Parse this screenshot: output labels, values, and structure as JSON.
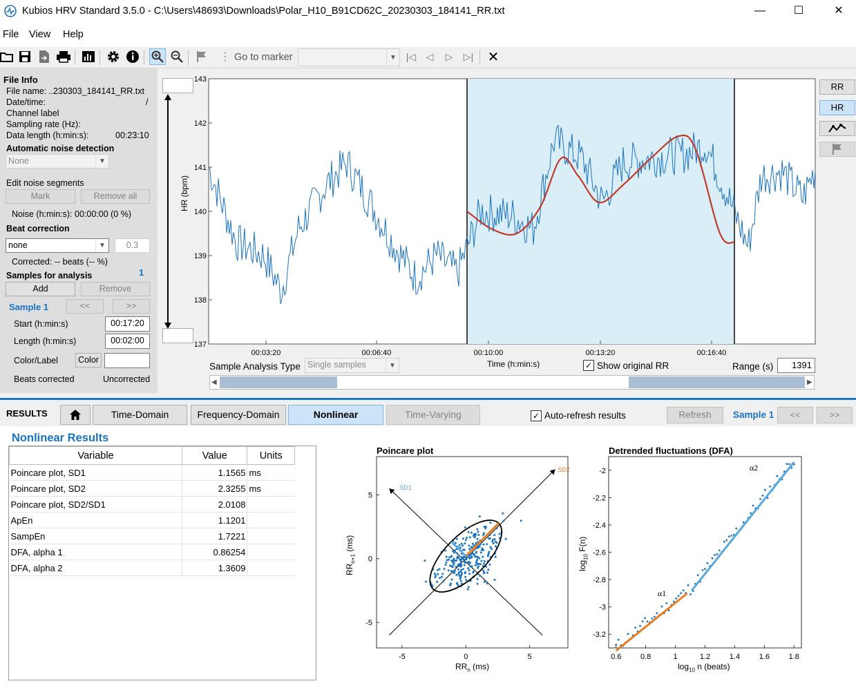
{
  "window": {
    "title": "Kubios HRV Standard 3.5.0 - C:\\Users\\48693\\Downloads\\Polar_H10_B91CD62C_20230303_184141_RR.txt",
    "controls": [
      "—",
      "☐",
      "✕"
    ]
  },
  "menu": [
    "File",
    "View",
    "Help"
  ],
  "toolbar": {
    "go_to_marker_label": "Go to marker",
    "icons": [
      "open-icon",
      "save-icon",
      "export-icon",
      "print-icon",
      "report-icon",
      "settings-icon",
      "info-icon",
      "zoom-in-icon",
      "zoom-out-icon",
      "flag-icon",
      "first-icon",
      "prev-icon",
      "next-icon",
      "last-icon",
      "close-icon"
    ]
  },
  "left_panel": {
    "file_info_title": "File Info",
    "file_name_label": "File name:",
    "file_name_value": "..230303_184141_RR.txt",
    "datetime_label": "Date/time:",
    "datetime_value": "/",
    "channel_label": "Channel label",
    "sampling_label": "Sampling rate (Hz):",
    "length_label": "Data length (h:min:s):",
    "length_value": "00:23:10",
    "auto_noise_title": "Automatic noise detection",
    "auto_noise_value": "None",
    "edit_noise_title": "Edit noise segments",
    "mark_label": "Mark",
    "remove_all_label": "Remove all",
    "noise_text": "Noise (h:min:s): 00:00:00 (0 %)",
    "beat_correction_title": "Beat correction",
    "beat_correction_value": "none",
    "beat_threshold": "0.3",
    "corrected_text": "Corrected: -- beats (-- %)",
    "samples_title": "Samples for analysis",
    "samples_count": "1",
    "add_label": "Add",
    "remove_label": "Remove",
    "sample_label": "Sample 1",
    "prev_label": "<<",
    "next_label": ">>",
    "start_label": "Start (h:min:s)",
    "start_value": "00:17:20",
    "length2_label": "Length (h:min:s)",
    "length2_value": "00:02:00",
    "color_label_label": "Color/Label",
    "color_btn": "Color",
    "beats_corrected_label": "Beats corrected",
    "beats_corrected_value": "Uncorrected"
  },
  "right_buttons": {
    "rr": "RR",
    "hr": "HR"
  },
  "hr_chart": {
    "ylabel": "HR (bpm)",
    "xlabel": "Time (h:min:s)",
    "yticks": [
      "143",
      "142",
      "141",
      "140",
      "139",
      "138",
      "137"
    ],
    "xticks": [
      "00:03:20",
      "00:06:40",
      "00:10:00",
      "00:13:20",
      "00:16:40"
    ],
    "sample_type_label": "Sample Analysis Type",
    "sample_type_value": "Single samples",
    "show_original_label": "Show original RR",
    "range_label": "Range (s)",
    "range_value": "1391",
    "line_color": "#1a73c2",
    "trend_color": "#c0392b",
    "highlight_color": "#d9eef7"
  },
  "results": {
    "label": "RESULTS",
    "tabs": [
      "Time-Domain",
      "Frequency-Domain",
      "Nonlinear",
      "Time-Varying"
    ],
    "active_tab": "Nonlinear",
    "auto_refresh_label": "Auto-refresh results",
    "refresh_label": "Refresh",
    "sample_label": "Sample 1",
    "prev_label": "<<",
    "next_label": ">>",
    "title": "Nonlinear Results",
    "columns": [
      "Variable",
      "Value",
      "Units"
    ],
    "rows": [
      [
        "Poincare plot, SD1",
        "1.1565",
        "ms"
      ],
      [
        "Poincare plot, SD2",
        "2.3255",
        "ms"
      ],
      [
        "Poincare plot, SD2/SD1",
        "2.0108",
        ""
      ],
      [
        "ApEn",
        "1.1201",
        ""
      ],
      [
        "SampEn",
        "1.7221",
        ""
      ],
      [
        "DFA, alpha 1",
        "0.86254",
        ""
      ],
      [
        "DFA, alpha 2",
        "1.3609",
        ""
      ]
    ]
  },
  "poincare": {
    "title": "Poincare plot",
    "xlabel": "RRn (ms)",
    "ylabel": "RRn+1 (ms)",
    "ticks": [
      "-5",
      "0",
      "5"
    ],
    "sd1_label": "SD1",
    "sd2_label": "SD2"
  },
  "dfa": {
    "title": "Detrended fluctuations (DFA)",
    "xlabel": "log10 n (beats)",
    "ylabel": "log10 F(n)",
    "xticks": [
      "0.6",
      "0.8",
      "1",
      "1.2",
      "1.4",
      "1.6",
      "1.8"
    ],
    "yticks": [
      "-2",
      "-2.2",
      "-2.4",
      "-2.6",
      "-2.8",
      "-3",
      "-3.2"
    ],
    "alpha1_label": "α1",
    "alpha2_label": "α2"
  }
}
